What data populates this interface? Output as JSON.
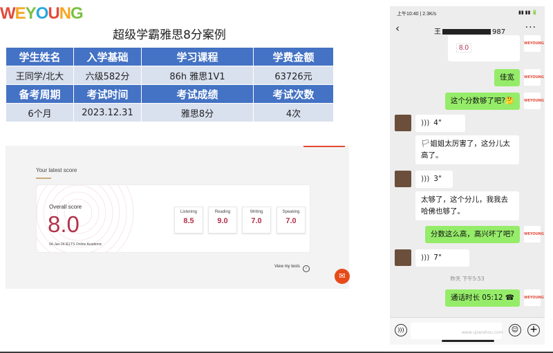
{
  "logo": {
    "text": "WEYOUNG"
  },
  "slide": {
    "title": "超级学霸雅思8分案例"
  },
  "info_table": {
    "rows": [
      {
        "type": "header",
        "cells": [
          "学生姓名",
          "入学基础",
          "学习课程",
          "学费金额"
        ]
      },
      {
        "type": "value",
        "cells": [
          "王同学/北大",
          "六级582分",
          "86h  雅思1V1",
          "63726元"
        ]
      },
      {
        "type": "header",
        "cells": [
          "备考周期",
          "考试时间",
          "考试成绩",
          "考试次数"
        ]
      },
      {
        "type": "value",
        "cells": [
          "6个月",
          "2023.12.31",
          "雅思8分",
          "4次"
        ]
      }
    ]
  },
  "score_card": {
    "heading": "Your latest score",
    "overall_label": "Overall score",
    "overall_value": "8.0",
    "test_meta": "04-Jan-24 IELTS Online Academic",
    "bands": [
      {
        "label": "Listening",
        "value": "8.5"
      },
      {
        "label": "Reading",
        "value": "9.0"
      },
      {
        "label": "Writing",
        "value": "7.0"
      },
      {
        "label": "Speaking",
        "value": "7.0"
      }
    ],
    "view_tests": "View my tests",
    "colors": {
      "accent": "#b4314a",
      "fab": "#e64a19"
    }
  },
  "phone": {
    "status_time": "上午10:40 | 2.3K/s",
    "status_right": "▮▮ ▮▮ 🔋",
    "contact_prefix": "王",
    "contact_suffix": "987",
    "preview_score": "8.0",
    "messages": [
      {
        "from": "me",
        "text": "佳宽"
      },
      {
        "from": "me",
        "text": "这个分数够了吧?🤔"
      },
      {
        "from": "them",
        "text": "4\""
      },
      {
        "from": "them",
        "text": "🏳姐姐太厉害了，这分儿太高了。"
      },
      {
        "from": "them",
        "text": "3\""
      },
      {
        "from": "them",
        "text": "太够了，这个分儿，我我去哈佛也够了。"
      },
      {
        "from": "me",
        "text": "分数这么高，高兴坏了吧?"
      },
      {
        "from": "them",
        "text": "7\""
      },
      {
        "from": "me",
        "text": "通话时长 05:12"
      }
    ],
    "timestamp": "昨天 下午5:53",
    "avatar_text": "WEYOUNG",
    "colors": {
      "my_bubble": "#95ec69",
      "their_bubble": "#ffffff"
    }
  },
  "watermark": "www.ujiaoshou.com"
}
